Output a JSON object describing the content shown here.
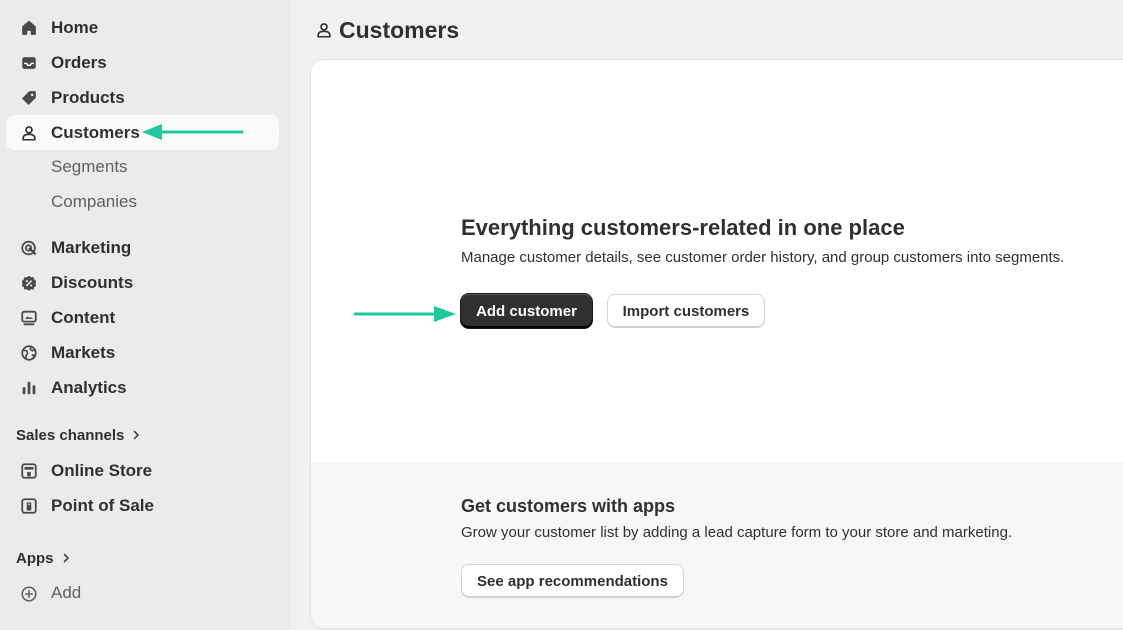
{
  "sidebar": {
    "nav": [
      {
        "label": "Home",
        "icon": "home-icon"
      },
      {
        "label": "Orders",
        "icon": "inbox-icon"
      },
      {
        "label": "Products",
        "icon": "tag-icon"
      },
      {
        "label": "Customers",
        "icon": "person-icon",
        "active": true
      }
    ],
    "customer_sub": [
      "Segments",
      "Companies"
    ],
    "nav2": [
      {
        "label": "Marketing",
        "icon": "target-icon"
      },
      {
        "label": "Discounts",
        "icon": "discount-icon"
      },
      {
        "label": "Content",
        "icon": "content-icon"
      },
      {
        "label": "Markets",
        "icon": "globe-icon"
      },
      {
        "label": "Analytics",
        "icon": "bar-chart-icon"
      }
    ],
    "sales_channels_label": "Sales channels",
    "channels": [
      {
        "label": "Online Store",
        "icon": "store-icon"
      },
      {
        "label": "Point of Sale",
        "icon": "pos-icon"
      }
    ],
    "apps_label": "Apps",
    "add_label": "Add"
  },
  "main": {
    "page_title": "Customers",
    "empty_state": {
      "title": "Everything customers-related in one place",
      "description": "Manage customer details, see customer order history, and group customers into segments.",
      "primary_button": "Add customer",
      "secondary_button": "Import customers"
    },
    "apps_section": {
      "title": "Get customers with apps",
      "description": "Grow your customer list by adding a lead capture form to your store and marketing.",
      "button": "See app recommendations"
    }
  },
  "colors": {
    "annotation_arrow": "#1fc9a0",
    "primary_button": "#303030",
    "sidebar_bg": "#ebebeb"
  }
}
